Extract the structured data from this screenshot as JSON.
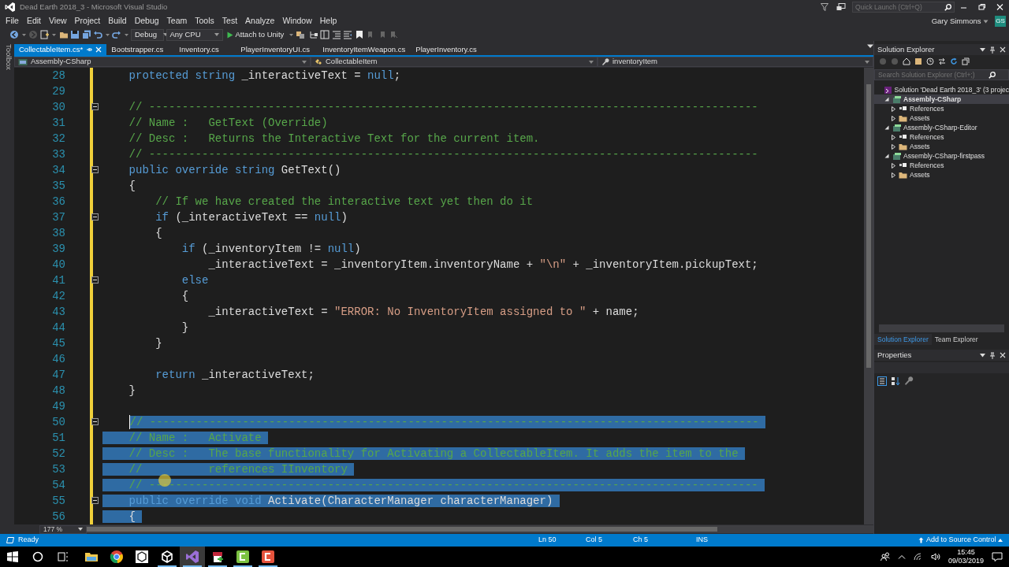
{
  "window": {
    "title": "Dead Earth 2018_3 - Microsoft Visual Studio"
  },
  "quick_launch": {
    "placeholder": "Quick Launch (Ctrl+Q)"
  },
  "account": {
    "name": "Gary Simmons",
    "initials": "GS"
  },
  "menu": [
    "File",
    "Edit",
    "View",
    "Project",
    "Build",
    "Debug",
    "Team",
    "Tools",
    "Test",
    "Analyze",
    "Window",
    "Help"
  ],
  "toolbar": {
    "configuration": "Debug",
    "platform": "Any CPU",
    "run_button": "Attach to Unity"
  },
  "toolbox_label": "Toolbox",
  "tabs": [
    {
      "label": "CollectableItem.cs*",
      "selected": true
    },
    {
      "label": "Bootstrapper.cs",
      "selected": false
    },
    {
      "label": "Inventory.cs",
      "selected": false
    },
    {
      "label": "PlayerInventoryUI.cs",
      "selected": false
    },
    {
      "label": "InventoryItemWeapon.cs",
      "selected": false
    },
    {
      "label": "PlayerInventory.cs",
      "selected": false
    }
  ],
  "nav_bar": {
    "project": "Assembly-CSharp",
    "type": "CollectableItem",
    "member": "inventoryItem"
  },
  "editor": {
    "zoom": "177 %",
    "lines": [
      {
        "num": "28",
        "fold": false,
        "modified": true,
        "selected": false,
        "caret": false,
        "tokens": [
          {
            "kind": "keyword",
            "text": "    protected string"
          },
          {
            "kind": "plain",
            "text": " _interactiveText = "
          },
          {
            "kind": "keyword",
            "text": "null"
          },
          {
            "kind": "plain",
            "text": ";"
          }
        ]
      },
      {
        "num": "29",
        "fold": false,
        "modified": true
      },
      {
        "num": "30",
        "fold": true,
        "modified": true,
        "selected": false,
        "caret": false,
        "tokens": [
          {
            "kind": "comment",
            "text": "    // --------------------------------------------------------------------------------------------"
          }
        ]
      },
      {
        "num": "31",
        "fold": false,
        "modified": true,
        "selected": false,
        "caret": false,
        "tokens": [
          {
            "kind": "comment",
            "text": "    // Name :   GetText (Override)"
          }
        ]
      },
      {
        "num": "32",
        "fold": false,
        "modified": true,
        "selected": false,
        "caret": false,
        "tokens": [
          {
            "kind": "comment",
            "text": "    // Desc :   Returns the Interactive Text for the current item."
          }
        ]
      },
      {
        "num": "33",
        "fold": false,
        "modified": true,
        "selected": false,
        "caret": false,
        "tokens": [
          {
            "kind": "comment",
            "text": "    // --------------------------------------------------------------------------------------------"
          }
        ]
      },
      {
        "num": "34",
        "fold": true,
        "modified": true,
        "selected": false,
        "caret": false,
        "tokens": [
          {
            "kind": "keyword",
            "text": "    public override string"
          },
          {
            "kind": "plain",
            "text": " GetText()"
          }
        ]
      },
      {
        "num": "35",
        "fold": false,
        "modified": true,
        "selected": false,
        "caret": false,
        "tokens": [
          {
            "kind": "plain",
            "text": "    {"
          }
        ]
      },
      {
        "num": "36",
        "fold": false,
        "modified": true,
        "selected": false,
        "caret": false,
        "tokens": [
          {
            "kind": "comment",
            "text": "        // If we have created the interactive text yet then do it"
          }
        ]
      },
      {
        "num": "37",
        "fold": true,
        "modified": true,
        "selected": false,
        "caret": false,
        "tokens": [
          {
            "kind": "keyword",
            "text": "        if"
          },
          {
            "kind": "plain",
            "text": " (_interactiveText == "
          },
          {
            "kind": "keyword",
            "text": "null"
          },
          {
            "kind": "plain",
            "text": ")"
          }
        ]
      },
      {
        "num": "38",
        "fold": false,
        "modified": true,
        "selected": false,
        "caret": false,
        "tokens": [
          {
            "kind": "plain",
            "text": "        {"
          }
        ]
      },
      {
        "num": "39",
        "fold": false,
        "modified": true,
        "selected": false,
        "caret": false,
        "tokens": [
          {
            "kind": "keyword",
            "text": "            if"
          },
          {
            "kind": "plain",
            "text": " (_inventoryItem != "
          },
          {
            "kind": "keyword",
            "text": "null"
          },
          {
            "kind": "plain",
            "text": ")"
          }
        ]
      },
      {
        "num": "40",
        "fold": false,
        "modified": true,
        "selected": false,
        "caret": false,
        "tokens": [
          {
            "kind": "plain",
            "text": "                _interactiveText = _inventoryItem.inventoryName + "
          },
          {
            "kind": "string",
            "text": "\"\\n\""
          },
          {
            "kind": "plain",
            "text": " + _inventoryItem.pickupText;"
          }
        ]
      },
      {
        "num": "41",
        "fold": true,
        "modified": true,
        "selected": false,
        "caret": false,
        "tokens": [
          {
            "kind": "keyword",
            "text": "            else"
          }
        ]
      },
      {
        "num": "42",
        "fold": false,
        "modified": true,
        "selected": false,
        "caret": false,
        "tokens": [
          {
            "kind": "plain",
            "text": "            {"
          }
        ]
      },
      {
        "num": "43",
        "fold": false,
        "modified": true,
        "selected": false,
        "caret": false,
        "tokens": [
          {
            "kind": "plain",
            "text": "                _interactiveText = "
          },
          {
            "kind": "string",
            "text": "\"ERROR: No InventoryItem assigned to \""
          },
          {
            "kind": "plain",
            "text": " + name;"
          }
        ]
      },
      {
        "num": "44",
        "fold": false,
        "modified": true,
        "selected": false,
        "caret": false,
        "tokens": [
          {
            "kind": "plain",
            "text": "            }"
          }
        ]
      },
      {
        "num": "45",
        "fold": false,
        "modified": true,
        "selected": false,
        "caret": false,
        "tokens": [
          {
            "kind": "plain",
            "text": "        }"
          }
        ]
      },
      {
        "num": "46",
        "fold": false,
        "modified": true
      },
      {
        "num": "47",
        "fold": false,
        "modified": true,
        "selected": false,
        "caret": false,
        "tokens": [
          {
            "kind": "keyword",
            "text": "        return"
          },
          {
            "kind": "plain",
            "text": " _interactiveText;"
          }
        ]
      },
      {
        "num": "48",
        "fold": false,
        "modified": true,
        "selected": false,
        "caret": false,
        "tokens": [
          {
            "kind": "plain",
            "text": "    }"
          }
        ]
      },
      {
        "num": "49",
        "fold": false,
        "modified": true
      },
      {
        "num": "50",
        "fold": true,
        "modified": true,
        "selected": true,
        "caret": true,
        "tokens": [
          {
            "kind": "comment",
            "text": "    // --------------------------------------------------------------------------------------------"
          }
        ]
      },
      {
        "num": "51",
        "fold": false,
        "modified": true,
        "selected": true,
        "caret": false,
        "tokens": [
          {
            "kind": "comment",
            "text": "    // Name :   Activate"
          }
        ]
      },
      {
        "num": "52",
        "fold": false,
        "modified": true,
        "selected": true,
        "caret": false,
        "tokens": [
          {
            "kind": "comment",
            "text": "    // Desc :   The base functionality for Activating a CollectableItem. It adds the item to the"
          }
        ]
      },
      {
        "num": "53",
        "fold": false,
        "modified": true,
        "selected": true,
        "caret": false,
        "tokens": [
          {
            "kind": "comment",
            "text": "    //          references IInventory"
          }
        ]
      },
      {
        "num": "54",
        "fold": false,
        "modified": true,
        "selected": true,
        "caret": false,
        "tokens": [
          {
            "kind": "comment",
            "text": "    // --------------------------------------------------------------------------------------------"
          }
        ]
      },
      {
        "num": "55",
        "fold": true,
        "modified": true,
        "selected": true,
        "caret": false,
        "tokens": [
          {
            "kind": "keyword",
            "text": "    public override void"
          },
          {
            "kind": "plain",
            "text": " Activate(CharacterManager characterManager)"
          }
        ]
      },
      {
        "num": "56",
        "fold": false,
        "modified": true,
        "selected": true,
        "caret": false,
        "tokens": [
          {
            "kind": "plain",
            "text": "    {"
          }
        ]
      }
    ]
  },
  "solution_explorer": {
    "title": "Solution Explorer",
    "search": {
      "placeholder": "Search Solution Explorer (Ctrl+;)"
    },
    "tree": [
      {
        "label": "Solution 'Dead Earth 2018_3' (3 projec",
        "kind": "solution",
        "selected": false,
        "children": [
          {
            "label": "Assembly-CSharp",
            "kind": "project",
            "selected": true,
            "expanded": true,
            "children": [
              {
                "label": "References",
                "kind": "references",
                "selected": false,
                "expanded": false
              },
              {
                "label": "Assets",
                "kind": "folder",
                "selected": false,
                "expanded": false
              }
            ]
          },
          {
            "label": "Assembly-CSharp-Editor",
            "kind": "project",
            "selected": false,
            "expanded": true,
            "children": [
              {
                "label": "References",
                "kind": "references",
                "selected": false,
                "expanded": false
              },
              {
                "label": "Assets",
                "kind": "folder",
                "selected": false,
                "expanded": false
              }
            ]
          },
          {
            "label": "Assembly-CSharp-firstpass",
            "kind": "project",
            "selected": false,
            "expanded": true,
            "children": [
              {
                "label": "References",
                "kind": "references",
                "selected": false,
                "expanded": false
              },
              {
                "label": "Assets",
                "kind": "folder",
                "selected": false,
                "expanded": false
              }
            ]
          }
        ]
      }
    ]
  },
  "panel_tabs": [
    {
      "label": "Solution Explorer",
      "selected": true
    },
    {
      "label": "Team Explorer",
      "selected": false
    }
  ],
  "properties": {
    "title": "Properties"
  },
  "status_bar": {
    "message": "Ready",
    "line": "Ln 50",
    "column": "Col 5",
    "char": "Ch 5",
    "mode": "INS",
    "source_control": "Add to Source Control"
  },
  "taskbar": {
    "apps": [
      {
        "kind": "folder",
        "running": false,
        "active": false
      },
      {
        "kind": "round",
        "running": false,
        "active": false
      },
      {
        "kind": "hub",
        "running": false,
        "active": false
      },
      {
        "kind": "cube",
        "running": true,
        "active": false
      },
      {
        "kind": "ide",
        "running": true,
        "active": true
      },
      {
        "kind": "paint",
        "running": true,
        "active": false
      },
      {
        "kind": "green",
        "running": true,
        "active": false
      },
      {
        "kind": "red",
        "running": true,
        "active": false
      }
    ],
    "time": "15:45",
    "date": "09/03/2019"
  }
}
